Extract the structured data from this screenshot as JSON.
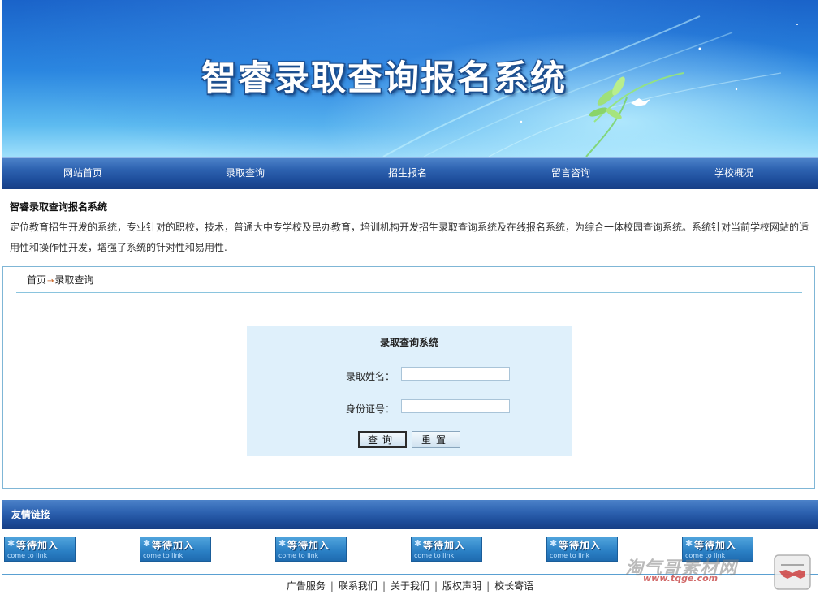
{
  "banner": {
    "title": "智睿录取查询报名系统"
  },
  "nav": {
    "items": [
      {
        "label": "网站首页"
      },
      {
        "label": "录取查询"
      },
      {
        "label": "招生报名"
      },
      {
        "label": "留言咨询"
      },
      {
        "label": "学校概况"
      }
    ]
  },
  "intro": {
    "title": "智睿录取查询报名系统",
    "text": "定位教育招生开发的系统，专业针对的职校，技术，普通大中专学校及民办教育，培训机构开发招生录取查询系统及在线报名系统，为综合一体校园查询系统。系统针对当前学校网站的适用性和操作性开发，增强了系统的针对性和易用性."
  },
  "breadcrumb": {
    "home": "首页",
    "arrow": "→",
    "current": "录取查询"
  },
  "query_form": {
    "title": "录取查询系统",
    "name_label": "录取姓名：",
    "name_value": "",
    "id_label": "身份证号：",
    "id_value": "",
    "submit_label": "查询",
    "reset_label": "重置"
  },
  "friend_links": {
    "title": "友情链接",
    "badge_text": "等待加入",
    "badge_subtext": "come to link",
    "badge_star": "✱"
  },
  "footer": {
    "links": [
      "广告服务",
      "联系我们",
      "关于我们",
      "版权声明",
      "校长寄语"
    ],
    "separator": "|"
  },
  "watermark": {
    "text": "淘气哥素材网",
    "url": "www.tqge.com"
  },
  "colors": {
    "nav_bar": "#1e4e9c",
    "query_box": "#dff0fb",
    "frame_border": "#7fb6d6",
    "footer_line": "#5aa0d2"
  }
}
